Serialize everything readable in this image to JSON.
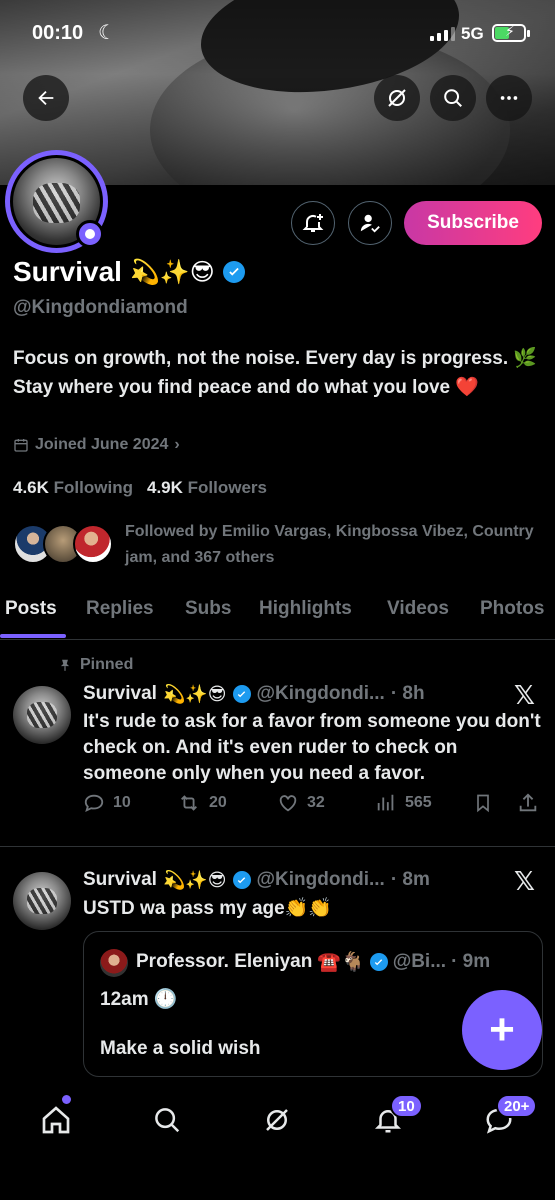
{
  "status_bar": {
    "time": "00:10",
    "network": "5G"
  },
  "profile": {
    "name": "Survival",
    "name_emojis": "💫✨😎",
    "handle": "@Kingdondiamond",
    "bio": "Focus on growth, not the noise. Every day is progress. 🌿 Stay where you find peace and do what you love ❤️",
    "joined": "Joined June 2024",
    "following_count": "4.6K",
    "following_label": "Following",
    "followers_count": "4.9K",
    "followers_label": "Followers",
    "followed_by": "Followed by Emilio Vargas, Kingbossa Vibez, Country jam, and 367 others",
    "subscribe_label": "Subscribe"
  },
  "tabs": [
    {
      "label": "Posts",
      "active": true
    },
    {
      "label": "Replies"
    },
    {
      "label": "Subs"
    },
    {
      "label": "Highlights"
    },
    {
      "label": "Videos"
    },
    {
      "label": "Photos"
    }
  ],
  "posts": [
    {
      "pinned_label": "Pinned",
      "name": "Survival",
      "emojis": "💫✨😎",
      "handle": "@Kingdondi...",
      "time": "· 8h",
      "text": "It's rude to ask for a favor from someone you don't check on. And it's even ruder to check on someone only when you need a favor.",
      "replies": "10",
      "reposts": "20",
      "likes": "32",
      "views": "565"
    },
    {
      "name": "Survival",
      "emojis": "💫✨😎",
      "handle": "@Kingdondi...",
      "time": "· 8m",
      "text": "USTD wa pass my age👏👏",
      "quote": {
        "name": "Professor. Eleniyan",
        "emojis": "☎️🐐",
        "handle": "@Bi...",
        "time": "· 9m",
        "line1": "12am 🕛",
        "line2": "Make a solid wish"
      }
    }
  ],
  "bottom_nav": {
    "notifications_badge": "10",
    "messages_badge": "20+"
  },
  "colors": {
    "accent": "#7b61ff",
    "verified": "#1d9bf0",
    "subscribe_from": "#c838a5",
    "subscribe_to": "#ff3d7f"
  }
}
